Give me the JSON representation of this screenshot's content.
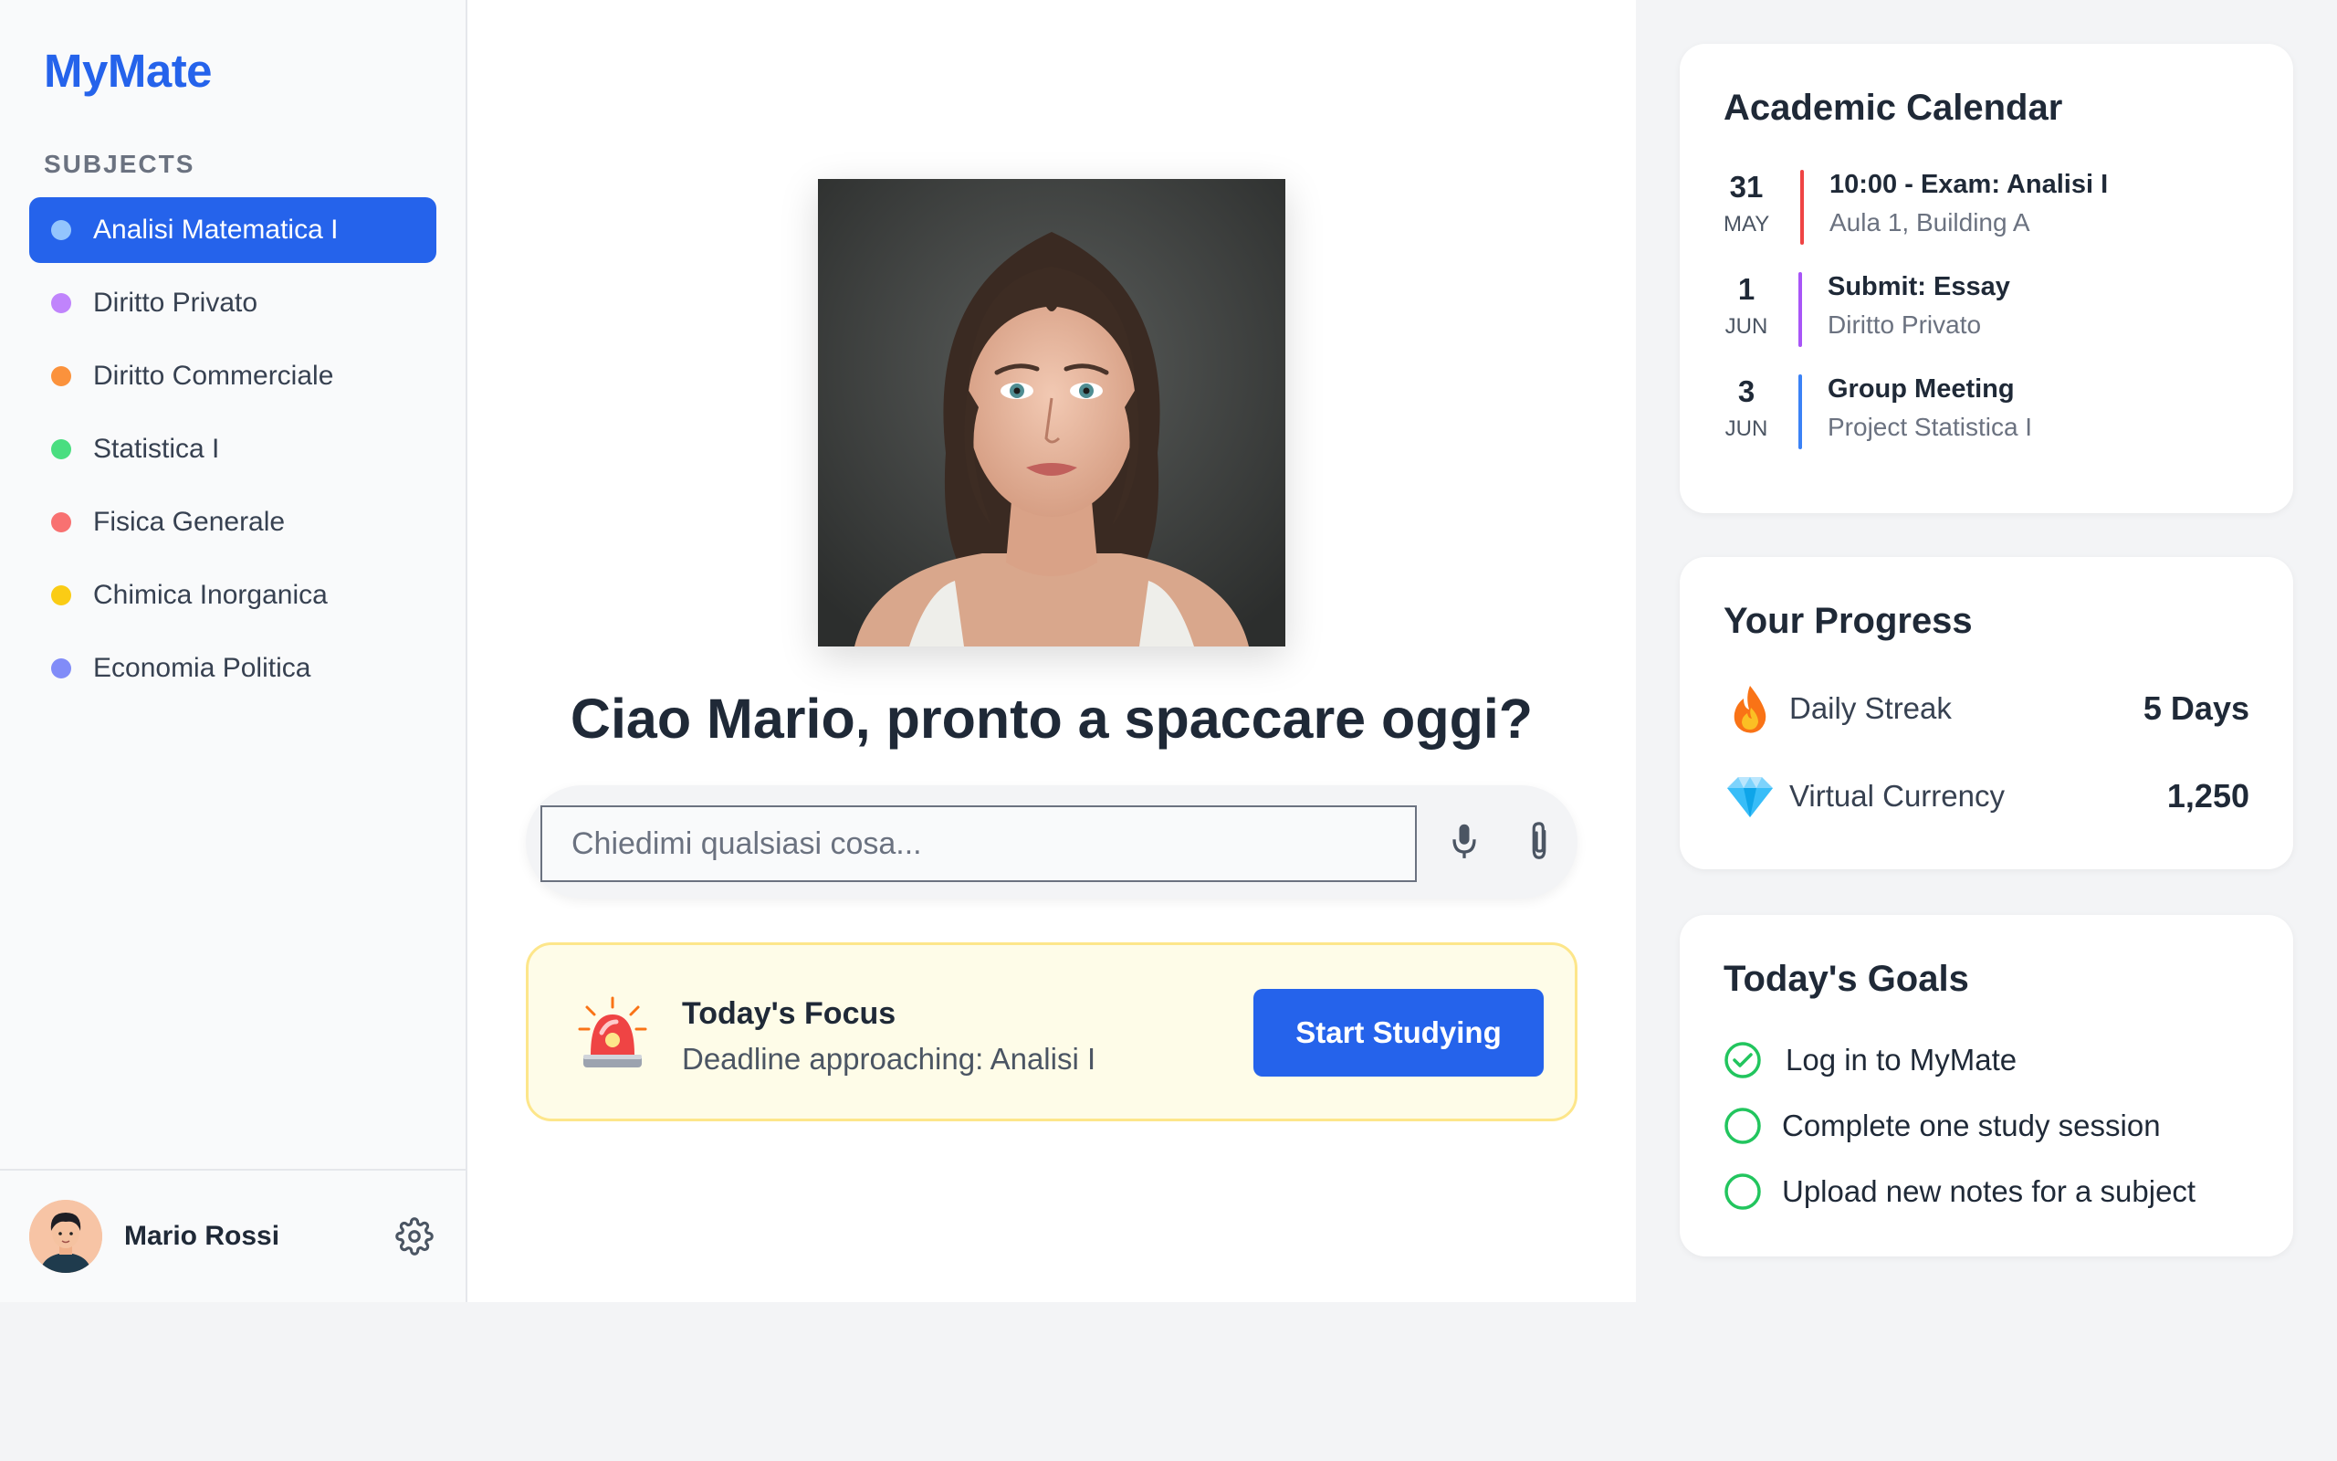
{
  "app": {
    "name": "MyMate",
    "accent": "#2563eb"
  },
  "sidebar": {
    "heading": "SUBJECTS",
    "subjects": [
      {
        "label": "Analisi Matematica I",
        "color": "#60a5fa",
        "active": true
      },
      {
        "label": "Diritto Privato",
        "color": "#c084fc",
        "active": false
      },
      {
        "label": "Diritto Commerciale",
        "color": "#fb923c",
        "active": false
      },
      {
        "label": "Statistica I",
        "color": "#4ade80",
        "active": false
      },
      {
        "label": "Fisica Generale",
        "color": "#f87171",
        "active": false
      },
      {
        "label": "Chimica Inorganica",
        "color": "#facc15",
        "active": false
      },
      {
        "label": "Economia Politica",
        "color": "#818cf8",
        "active": false
      }
    ],
    "user": {
      "name": "Mario Rossi",
      "avatar_icon": "user-avatar",
      "settings_icon": "gear-icon"
    }
  },
  "main": {
    "portrait_icon": "assistant-portrait",
    "greeting": "Ciao Mario, pronto a spaccare oggi?",
    "search": {
      "placeholder": "Chiedimi qualsiasi cosa...",
      "value": "",
      "mic_icon": "microphone-icon",
      "attach_icon": "paperclip-icon"
    },
    "focus": {
      "icon": "siren-icon",
      "title": "Today's Focus",
      "subtitle": "Deadline approaching: Analisi I",
      "button": "Start Studying"
    }
  },
  "calendar": {
    "title": "Academic Calendar",
    "events": [
      {
        "day": "31",
        "month": "MAY",
        "title": "10:00 - Exam: Analisi I",
        "subtitle": "Aula 1, Building A",
        "color": "#ef4444"
      },
      {
        "day": "1",
        "month": "JUN",
        "title": "Submit: Essay",
        "subtitle": "Diritto Privato",
        "color": "#a855f7"
      },
      {
        "day": "3",
        "month": "JUN",
        "title": "Group Meeting",
        "subtitle": "Project Statistica I",
        "color": "#3b82f6"
      }
    ]
  },
  "progress": {
    "title": "Your Progress",
    "items": [
      {
        "icon": "fire-icon",
        "label": "Daily Streak",
        "value": "5 Days"
      },
      {
        "icon": "gem-icon",
        "label": "Virtual Currency",
        "value": "1,250"
      }
    ]
  },
  "goals": {
    "title": "Today's Goals",
    "items": [
      {
        "label": "Log in to MyMate",
        "done": true
      },
      {
        "label": "Complete one study session",
        "done": false
      },
      {
        "label": "Upload new notes for a subject",
        "done": false
      }
    ]
  }
}
